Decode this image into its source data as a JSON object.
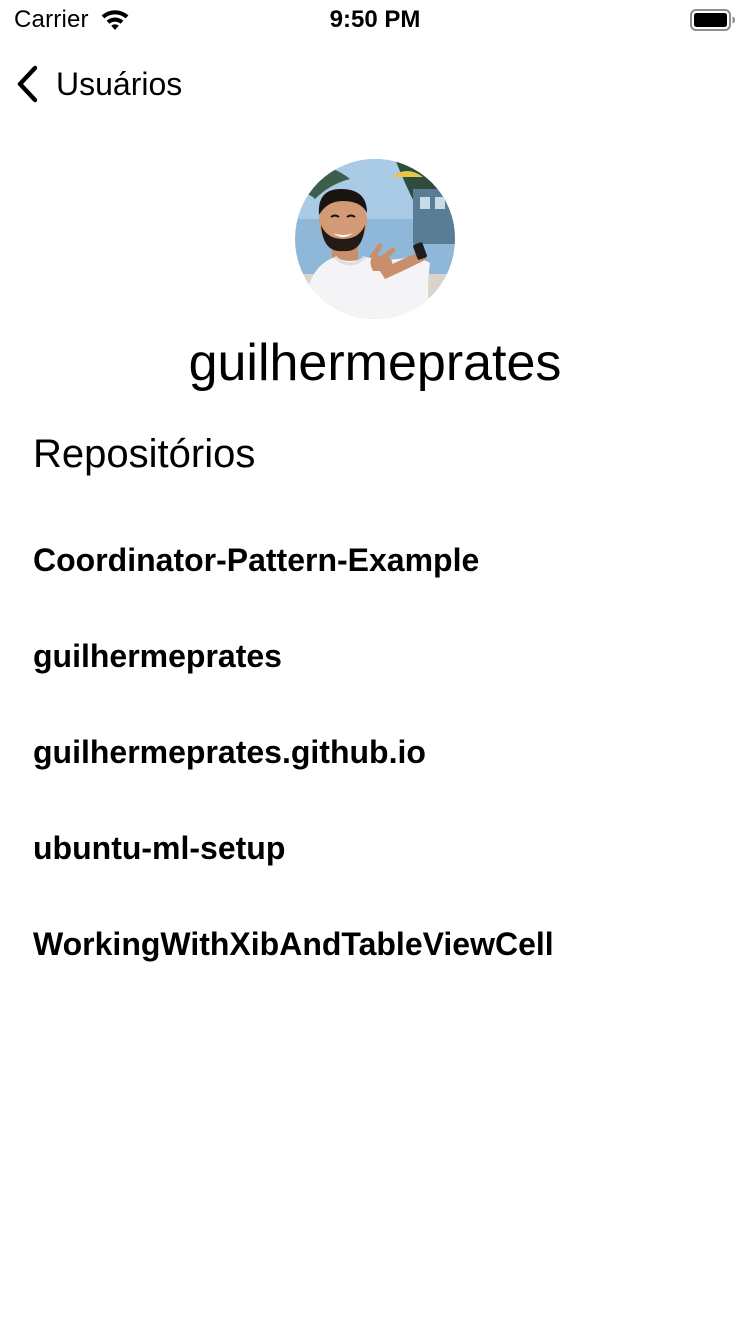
{
  "status_bar": {
    "carrier": "Carrier",
    "time": "9:50 PM",
    "wifi_icon": "wifi-icon",
    "battery_icon": "battery-full-icon"
  },
  "nav": {
    "back_label": "Usuários",
    "back_icon": "chevron-left-icon"
  },
  "profile": {
    "avatar_icon": "user-avatar-photo",
    "username": "guilhermeprates"
  },
  "repositories": {
    "title": "Repositórios",
    "items": [
      {
        "name": "Coordinator-Pattern-Example"
      },
      {
        "name": "guilhermeprates"
      },
      {
        "name": "guilhermeprates.github.io"
      },
      {
        "name": "ubuntu-ml-setup"
      },
      {
        "name": "WorkingWithXibAndTableViewCell"
      }
    ]
  },
  "colors": {
    "background": "#ffffff",
    "text": "#000000"
  }
}
